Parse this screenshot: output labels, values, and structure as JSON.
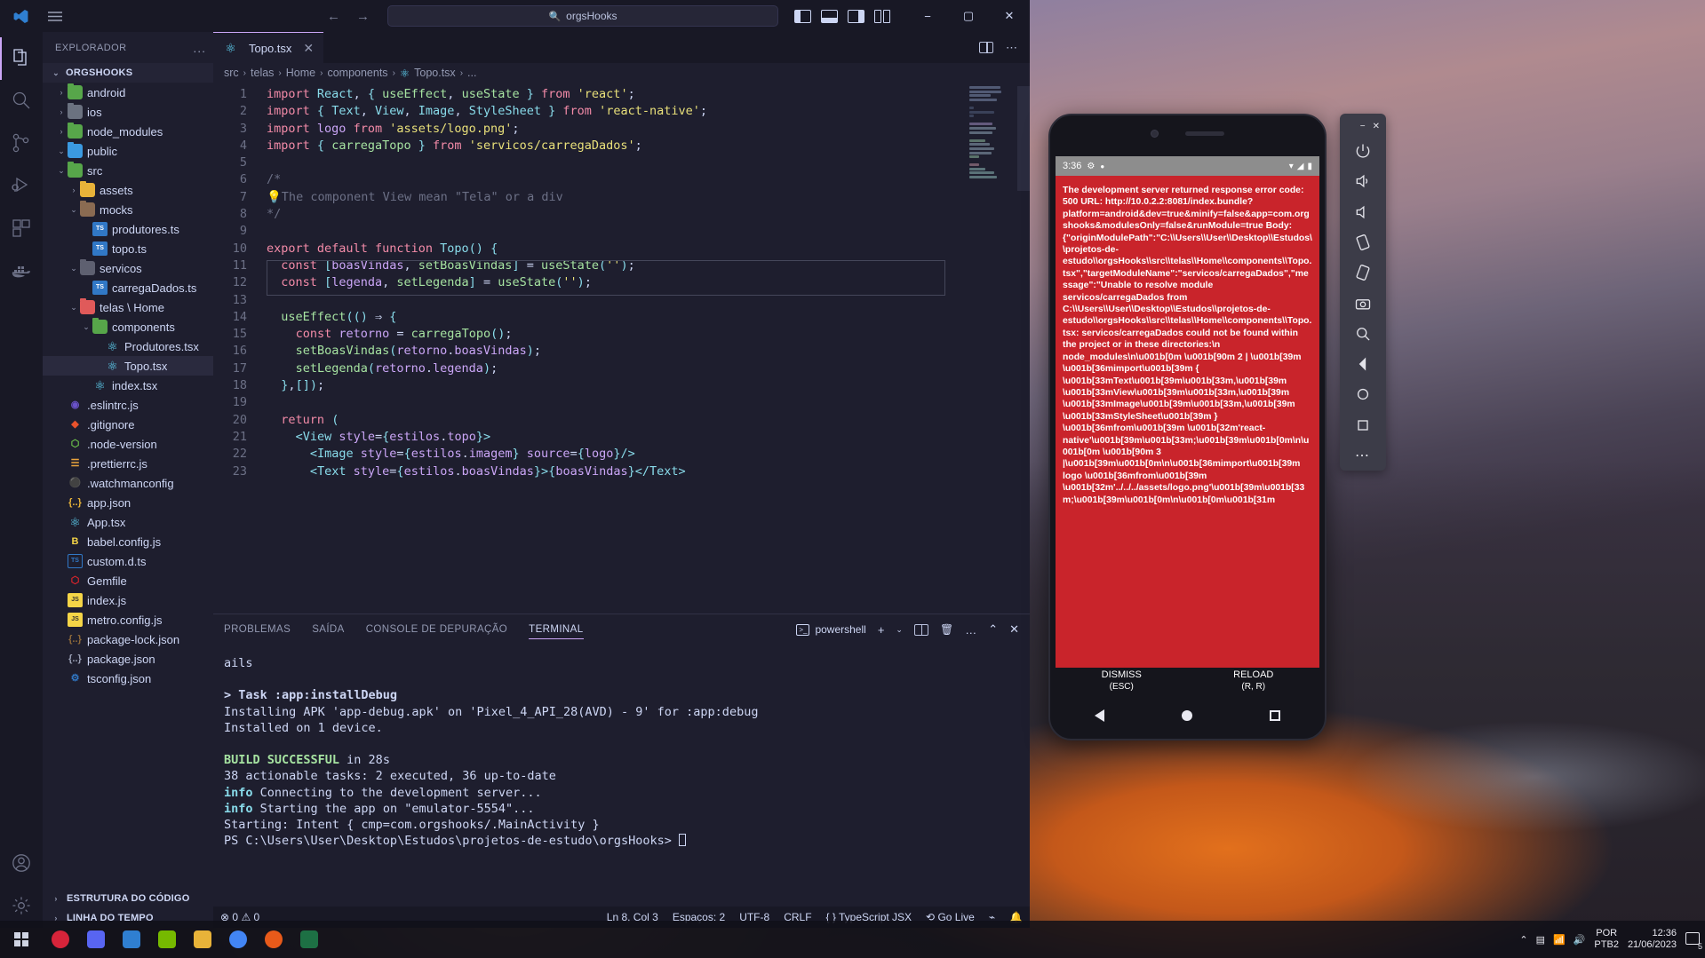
{
  "window": {
    "search_value": "orgsHooks",
    "search_icon": "search-icon",
    "nav_back": "←",
    "nav_forward": "→",
    "minimize": "−",
    "maximize": "▢",
    "close": "✕"
  },
  "activitybar": {
    "items": [
      {
        "name": "explorer",
        "icon": "files-icon"
      },
      {
        "name": "search",
        "icon": "search-icon"
      },
      {
        "name": "source-control",
        "icon": "source-control-icon"
      },
      {
        "name": "run-and-debug",
        "icon": "run-debug-icon"
      },
      {
        "name": "extensions",
        "icon": "extensions-icon"
      },
      {
        "name": "docker",
        "icon": "docker-icon"
      },
      {
        "name": "accounts",
        "icon": "account-icon"
      },
      {
        "name": "manage",
        "icon": "gear-icon"
      }
    ]
  },
  "explorer": {
    "title": "EXPLORADOR",
    "more_actions": "...",
    "root": "ORGSHOOKS",
    "tree": [
      {
        "label": "android",
        "indent": 1,
        "chev": "›",
        "icon": "folder-green",
        "selected": false
      },
      {
        "label": "ios",
        "indent": 1,
        "chev": "›",
        "icon": "folder-gray",
        "selected": false
      },
      {
        "label": "node_modules",
        "indent": 1,
        "chev": "›",
        "icon": "folder-green",
        "selected": false
      },
      {
        "label": "public",
        "indent": 1,
        "chev": "⌄",
        "icon": "folder-blue",
        "selected": false
      },
      {
        "label": "src",
        "indent": 1,
        "chev": "⌄",
        "icon": "folder-green",
        "selected": false
      },
      {
        "label": "assets",
        "indent": 2,
        "chev": "›",
        "icon": "folder-yellow",
        "selected": false
      },
      {
        "label": "mocks",
        "indent": 2,
        "chev": "⌄",
        "icon": "folder-brown",
        "selected": false
      },
      {
        "label": "produtores.ts",
        "indent": 3,
        "chev": "",
        "icon": "ts-file",
        "selected": false
      },
      {
        "label": "topo.ts",
        "indent": 3,
        "chev": "",
        "icon": "ts-file",
        "selected": false
      },
      {
        "label": "servicos",
        "indent": 2,
        "chev": "⌄",
        "icon": "folder-dim",
        "selected": false
      },
      {
        "label": "carregaDados.ts",
        "indent": 3,
        "chev": "",
        "icon": "ts-file",
        "selected": false
      },
      {
        "label": "telas \\ Home",
        "indent": 2,
        "chev": "⌄",
        "icon": "folder-red",
        "selected": false
      },
      {
        "label": "components",
        "indent": 3,
        "chev": "⌄",
        "icon": "folder-green",
        "selected": false
      },
      {
        "label": "Produtores.tsx",
        "indent": 4,
        "chev": "",
        "icon": "react-file",
        "selected": false
      },
      {
        "label": "Topo.tsx",
        "indent": 4,
        "chev": "",
        "icon": "react-file",
        "selected": true
      },
      {
        "label": "index.tsx",
        "indent": 3,
        "chev": "",
        "icon": "react-file",
        "selected": false
      },
      {
        "label": ".eslintrc.js",
        "indent": 1,
        "chev": "",
        "icon": "eslint-file",
        "selected": false
      },
      {
        "label": ".gitignore",
        "indent": 1,
        "chev": "",
        "icon": "git-file",
        "selected": false
      },
      {
        "label": ".node-version",
        "indent": 1,
        "chev": "",
        "icon": "node-file",
        "selected": false
      },
      {
        "label": ".prettierrc.js",
        "indent": 1,
        "chev": "",
        "icon": "prettier-file",
        "selected": false
      },
      {
        "label": ".watchmanconfig",
        "indent": 1,
        "chev": "",
        "icon": "watchman-file",
        "selected": false
      },
      {
        "label": "app.json",
        "indent": 1,
        "chev": "",
        "icon": "json-file",
        "selected": false
      },
      {
        "label": "App.tsx",
        "indent": 1,
        "chev": "",
        "icon": "react-file",
        "selected": false
      },
      {
        "label": "babel.config.js",
        "indent": 1,
        "chev": "",
        "icon": "babel-file",
        "selected": false
      },
      {
        "label": "custom.d.ts",
        "indent": 1,
        "chev": "",
        "icon": "ts-outline",
        "selected": false
      },
      {
        "label": "Gemfile",
        "indent": 1,
        "chev": "",
        "icon": "ruby-file",
        "selected": false
      },
      {
        "label": "index.js",
        "indent": 1,
        "chev": "",
        "icon": "js-file",
        "selected": false
      },
      {
        "label": "metro.config.js",
        "indent": 1,
        "chev": "",
        "icon": "js-file",
        "selected": false
      },
      {
        "label": "package-lock.json",
        "indent": 1,
        "chev": "",
        "icon": "json-lock-file",
        "selected": false
      },
      {
        "label": "package.json",
        "indent": 1,
        "chev": "",
        "icon": "json-file-2",
        "selected": false
      },
      {
        "label": "tsconfig.json",
        "indent": 1,
        "chev": "",
        "icon": "tsconfig-file",
        "selected": false
      }
    ],
    "sections": [
      {
        "label": "ESTRUTURA DO CÓDIGO",
        "chev": "›"
      },
      {
        "label": "LINHA DO TEMPO",
        "chev": "›"
      }
    ]
  },
  "editor": {
    "tab": {
      "label": "Topo.tsx",
      "icon": "react-icon",
      "close": "✕"
    },
    "breadcrumb": [
      "src",
      "telas",
      "Home",
      "components",
      "Topo.tsx",
      "..."
    ],
    "line_numbers": [
      "1",
      "2",
      "3",
      "4",
      "5",
      "6",
      "7",
      "8",
      "9",
      "10",
      "11",
      "12",
      "13",
      "14",
      "15",
      "16",
      "17",
      "18",
      "19",
      "20",
      "21",
      "22",
      "23"
    ],
    "code_lines": [
      "import React, { useEffect, useState } from 'react';",
      "import { Text, View, Image, StyleSheet } from 'react-native';",
      "import logo from 'assets/logo.png';",
      "import { carregaTopo } from 'servicos/carregaDados';",
      "",
      "/*",
      "💡The component View mean \"Tela\" or a div",
      "*/",
      "",
      "export default function Topo() {",
      "  const [boasVindas, setBoasVindas] = useState('');",
      "  const [legenda, setLegenda] = useState('');",
      "",
      "  useEffect(() ⇒ {",
      "    const retorno = carregaTopo();",
      "    setBoasVindas(retorno.boasVindas);",
      "    setLegenda(retorno.legenda);",
      "  },[]);",
      "",
      "  return (",
      "    <View style={estilos.topo}>",
      "      <Image style={estilos.imagem} source={logo}/>",
      "      <Text style={estilos.boasVindas}>{boasVindas}</Text>"
    ]
  },
  "panel": {
    "tabs": [
      {
        "label": "PROBLEMAS",
        "active": false
      },
      {
        "label": "SAÍDA",
        "active": false
      },
      {
        "label": "CONSOLE DE DEPURAÇÃO",
        "active": false
      },
      {
        "label": "TERMINAL",
        "active": true
      }
    ],
    "shell": "powershell",
    "actions": {
      "new": "+",
      "split": "⫿",
      "kill": "🗑",
      "more": "…",
      "maximize": "⌃",
      "close": "✕"
    },
    "terminal_output": [
      {
        "text": "ails",
        "style": "plain"
      },
      {
        "text": "",
        "style": "plain"
      },
      {
        "text": "> Task :app:installDebug",
        "style": "bold"
      },
      {
        "text": "Installing APK 'app-debug.apk' on 'Pixel_4_API_28(AVD) - 9' for :app:debug",
        "style": "plain"
      },
      {
        "text": "Installed on 1 device.",
        "style": "plain"
      },
      {
        "text": "",
        "style": "plain"
      },
      {
        "text": "BUILD SUCCESSFUL| in 28s",
        "style": "green-prefix"
      },
      {
        "text": "38 actionable tasks: 2 executed, 36 up-to-date",
        "style": "plain"
      },
      {
        "text": "info| Connecting to the development server...",
        "style": "cyan-prefix"
      },
      {
        "text": "info| Starting the app on \"emulator-5554\"...",
        "style": "cyan-prefix"
      },
      {
        "text": "Starting: Intent { cmp=com.orgshooks/.MainActivity }",
        "style": "plain"
      },
      {
        "text": "PS C:\\Users\\User\\Desktop\\Estudos\\projetos-de-estudo\\orgsHooks>",
        "style": "prompt"
      }
    ]
  },
  "statusbar": {
    "errors": "0",
    "warnings": "0",
    "position": "Ln 8, Col 3",
    "spaces": "Espaços: 2",
    "encoding": "UTF-8",
    "eol": "CRLF",
    "language": "TypeScript JSX",
    "golive": "Go Live",
    "bell_icon": "bell-icon",
    "feedback_icon": "feedback-icon"
  },
  "emulator": {
    "status_time": "3:36",
    "status_icons": [
      "gear-icon",
      "dot-icon",
      "wifi-icon",
      "signal-icon",
      "battery-icon"
    ],
    "error_text": "The development server returned response error code: 500\n\nURL: http://10.0.2.2:8081/index.bundle?platform=android&dev=true&minify=false&app=com.orgshooks&modulesOnly=false&runModule=true\n\nBody:\n{\"originModulePath\":\"C:\\\\Users\\\\User\\\\Desktop\\\\Estudos\\\\projetos-de-estudo\\\\orgsHooks\\\\src\\\\telas\\\\Home\\\\components\\\\Topo.tsx\",\"targetModuleName\":\"servicos/carregaDados\",\"message\":\"Unable to resolve module servicos/carregaDados from C:\\\\Users\\\\User\\\\Desktop\\\\Estudos\\\\projetos-de-estudo\\\\orgsHooks\\\\src\\\\telas\\\\Home\\\\components\\\\Topo.tsx: servicos/carregaDados could not be found within the project or in these directories:\\n  node_modules\\n\\u001b[0m \\u001b[90m 2 | \\u001b[39m \\u001b[36mimport\\u001b[39m { \\u001b[33mText\\u001b[39m\\u001b[33m,\\u001b[39m \\u001b[33mView\\u001b[39m\\u001b[33m,\\u001b[39m \\u001b[33mImage\\u001b[39m\\u001b[33m,\\u001b[39m \\u001b[33mStyleSheet\\u001b[39m } \\u001b[36mfrom\\u001b[39m \\u001b[32m'react-native'\\u001b[39m\\u001b[33m;\\u001b[39m\\u001b[0m\\n\\u001b[0m \\u001b[90m 3 |\\u001b[39m\\u001b[0m\\n\\u001b[36mimport\\u001b[39m logo \\u001b[36mfrom\\u001b[39m \\u001b[32m'../../../assets/logo.png'\\u001b[39m\\u001b[33m;\\u001b[39m\\u001b[0m\\n\\u001b[0m\\u001b[31m",
    "dismiss_label": "DISMISS",
    "dismiss_key": "(ESC)",
    "reload_label": "RELOAD",
    "reload_key": "(R, R)",
    "nav": [
      "back-icon",
      "home-icon",
      "recents-icon"
    ],
    "tools": [
      "close-icon",
      "minimize-icon",
      "power-icon",
      "volume-up-icon",
      "volume-down-icon",
      "rotate-left-icon",
      "rotate-right-icon",
      "camera-icon",
      "zoom-icon",
      "back-icon",
      "home-icon",
      "overview-icon",
      "more-icon"
    ]
  },
  "taskbar": {
    "start": "windows-logo",
    "apps": [
      "opera-icon",
      "discord-icon",
      "vscode-icon",
      "nvidia-icon",
      "folder-icon",
      "chrome-icon",
      "avast-icon",
      "excel-icon"
    ],
    "language_line1": "POR",
    "language_line2": "PTB2",
    "time": "12:36",
    "date": "21/06/2023",
    "notification_count": "5"
  }
}
